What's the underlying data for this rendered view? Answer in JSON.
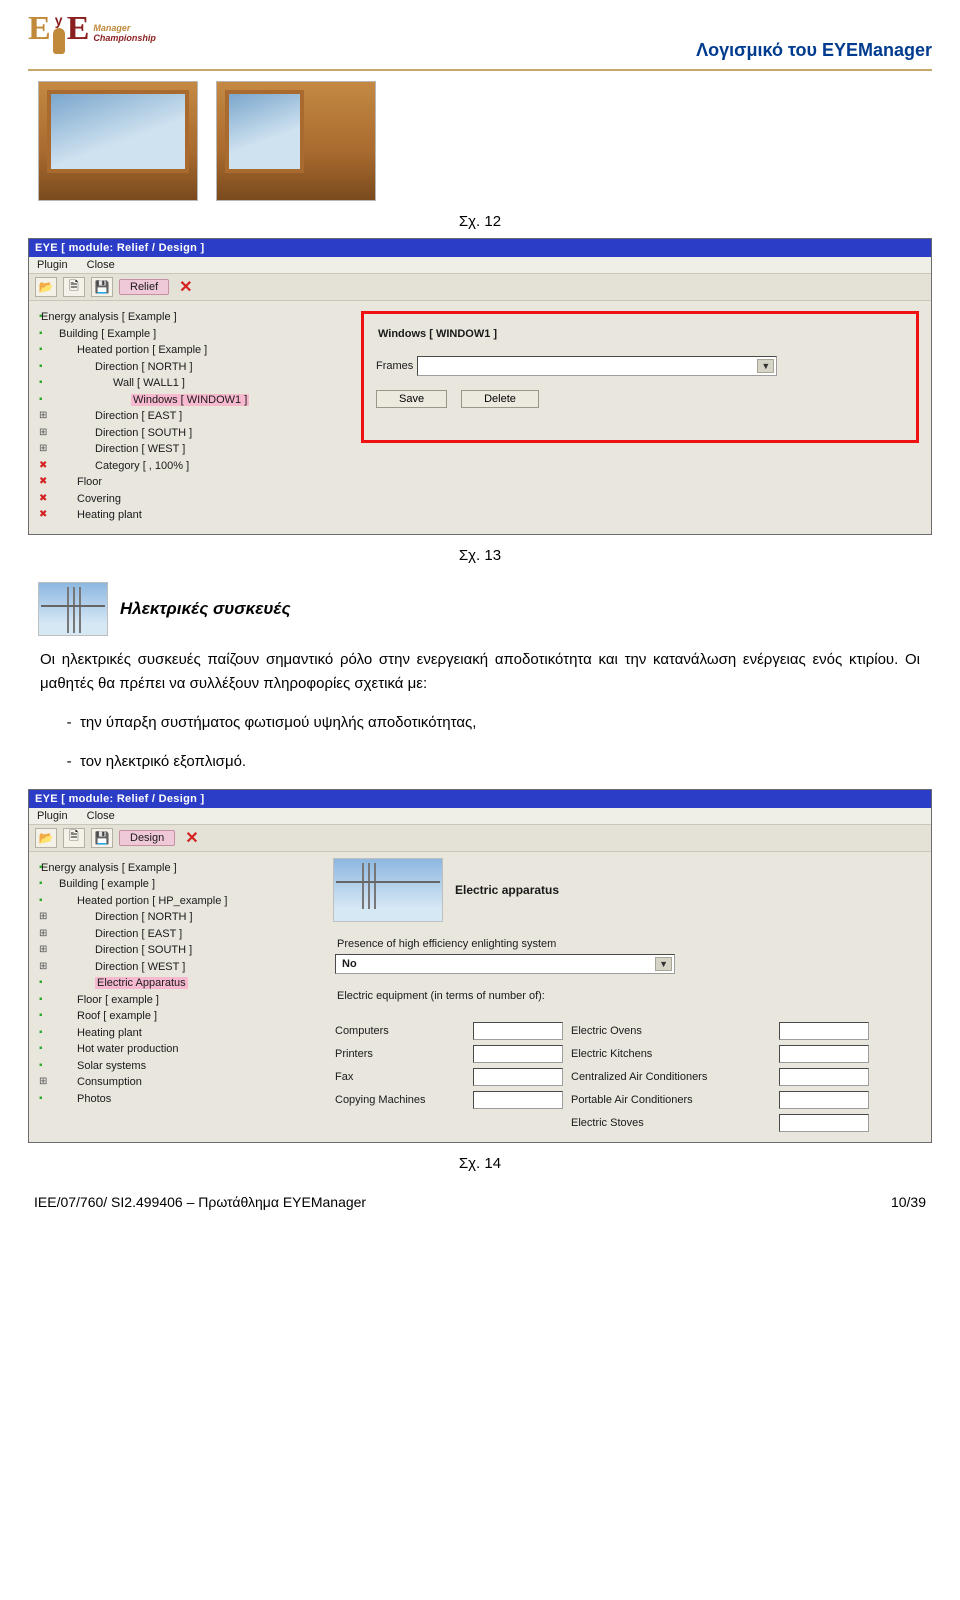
{
  "header": {
    "logo_sub1": "Manager",
    "logo_sub2": "Championship",
    "title": "Λογισμικό του EYEManager"
  },
  "fig12": "Σχ. 12",
  "fig13": "Σχ. 13",
  "fig14": "Σχ. 14",
  "app1": {
    "title": "EYE [ module: Relief / Design ]",
    "menu": {
      "plugin": "Plugin",
      "close": "Close"
    },
    "tab": "Relief",
    "tree": {
      "n1": "Energy analysis [ Example ]",
      "n2": "Building [ Example ]",
      "n3": "Heated portion [ Example ]",
      "n4": "Direction [ NORTH ]",
      "n5": "Wall [ WALL1 ]",
      "n6": "Windows [ WINDOW1 ]",
      "n7": "Direction [ EAST ]",
      "n8": "Direction [ SOUTH ]",
      "n9": "Direction [ WEST ]",
      "n10": "Category [ , 100% ]",
      "n11": "Floor",
      "n12": "Covering",
      "n13": "Heating plant"
    },
    "form": {
      "heading": "Windows [ WINDOW1 ]",
      "frames": "Frames",
      "save": "Save",
      "delete": "Delete"
    }
  },
  "section": {
    "title": "Ηλεκτρικές συσκευές",
    "para": "Οι ηλεκτρικές συσκευές παίζουν σημαντικό ρόλο στην ενεργειακή αποδοτικότητα και την κατανάλωση ενέργειας ενός κτιρίου. Οι μαθητές θα πρέπει να συλλέξουν πληροφορίες σχετικά με:",
    "li1": "την ύπαρξη συστήματος φωτισμού υψηλής αποδοτικότητας,",
    "li2": "τον ηλεκτρικό εξοπλισμό."
  },
  "app2": {
    "title": "EYE [ module: Relief / Design ]",
    "menu": {
      "plugin": "Plugin",
      "close": "Close"
    },
    "tab": "Design",
    "tree": {
      "n1": "Energy analysis [ Example ]",
      "n2": "Building [ example ]",
      "n3": "Heated portion [ HP_example ]",
      "n4": "Direction [ NORTH ]",
      "n5": "Direction [ EAST ]",
      "n6": "Direction [ SOUTH ]",
      "n7": "Direction [ WEST ]",
      "n8": "Electric Apparatus",
      "n9": "Floor [ example ]",
      "n10": "Roof [ example ]",
      "n11": "Heating plant",
      "n12": "Hot water production",
      "n13": "Solar systems",
      "n14": "Consumption",
      "n15": "Photos"
    },
    "right": {
      "heading": "Electric apparatus",
      "presence_caption": "Presence of high efficiency enlighting system",
      "presence_value": "No",
      "equip_caption": "Electric equipment (in terms of number of):",
      "rows": {
        "r1a": "Computers",
        "r1b": "Electric Ovens",
        "r2a": "Printers",
        "r2b": "Electric Kitchens",
        "r3a": "Fax",
        "r3b": "Centralized Air Conditioners",
        "r4a": "Copying Machines",
        "r4b": "Portable Air Conditioners",
        "r5b": "Electric Stoves"
      }
    }
  },
  "footer": {
    "left": "IEE/07/760/ SI2.499406 – Πρωτάθλημα EYEManager",
    "right": "10/39"
  }
}
